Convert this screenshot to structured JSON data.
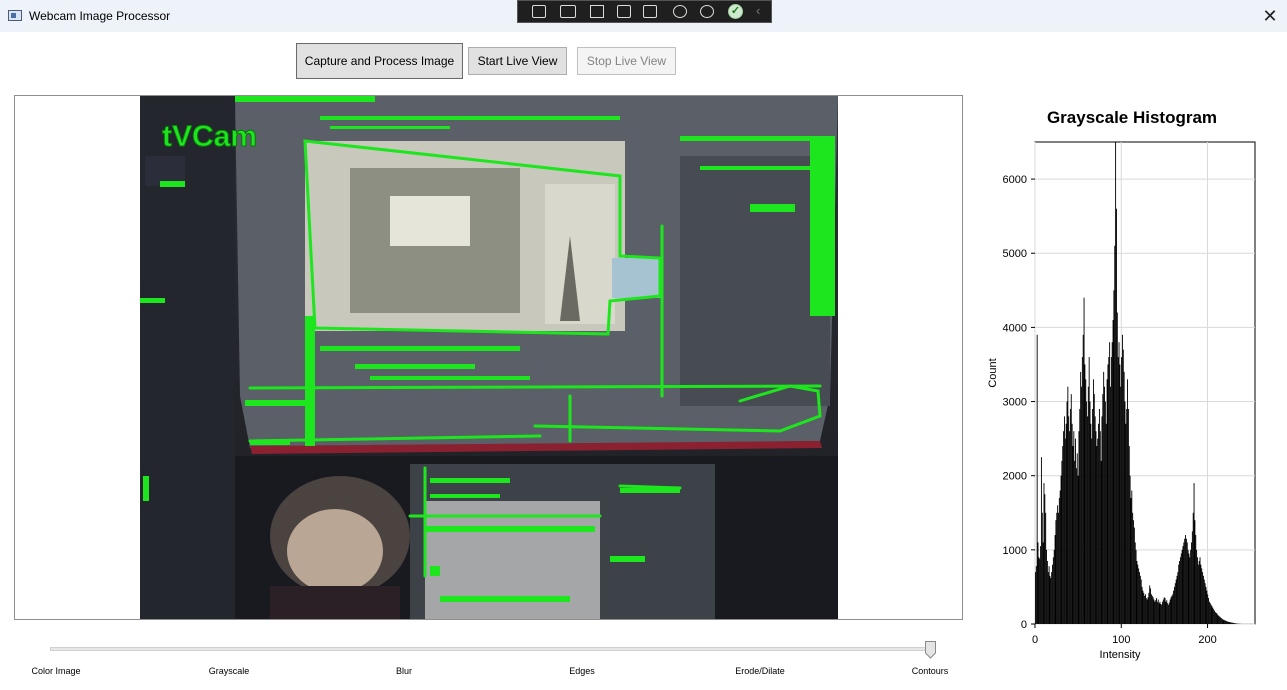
{
  "window": {
    "title": "Webcam Image Processor",
    "close_glyph": "✕"
  },
  "toolbar": {
    "capture_label": "Capture and Process Image",
    "start_label": "Start Live View",
    "stop_label": "Stop Live View"
  },
  "overlay_toolbar": {
    "icons": [
      "select-region-icon",
      "video-icon",
      "pointer-icon",
      "frame-icon",
      "pointer-window-icon",
      "accessibility-icon",
      "person-icon"
    ],
    "check_glyph": "✓",
    "chevron_glyph": "‹"
  },
  "camera": {
    "watermark": "tVCam"
  },
  "chart_data": {
    "type": "bar",
    "title": "Grayscale Histogram",
    "xlabel": "Intensity",
    "ylabel": "Count",
    "xlim": [
      0,
      255
    ],
    "ylim": [
      0,
      6500
    ],
    "xticks": [
      0,
      100,
      200
    ],
    "yticks": [
      0,
      1000,
      2000,
      3000,
      4000,
      5000,
      6000
    ],
    "grid": true,
    "legend": "none",
    "bar_color": "#000000",
    "values": [
      700,
      780,
      3900,
      1100,
      900,
      880,
      1050,
      2250,
      1500,
      1100,
      1900,
      1750,
      1500,
      1000,
      850,
      700,
      780,
      650,
      620,
      700,
      800,
      900,
      1000,
      1200,
      1400,
      1500,
      1600,
      1500,
      1700,
      1800,
      2000,
      2200,
      2400,
      2600,
      2800,
      2500,
      2700,
      3000,
      3200,
      2800,
      2600,
      2900,
      3100,
      2700,
      2400,
      2600,
      2200,
      2500,
      2100,
      2300,
      2000,
      2600,
      2900,
      3400,
      3200,
      3600,
      3900,
      4400,
      3500,
      3300,
      3000,
      2800,
      3200,
      3600,
      3000,
      2700,
      2500,
      2900,
      3300,
      3100,
      2800,
      2600,
      2400,
      2500,
      2700,
      2900,
      2600,
      2200,
      2800,
      3100,
      3400,
      3200,
      3000,
      2700,
      3300,
      3500,
      3600,
      3800,
      3200,
      3600,
      3800,
      4100,
      4500,
      5100,
      6500,
      5600,
      4200,
      3600,
      3800,
      3500,
      3200,
      3600,
      3900,
      3700,
      3400,
      3000,
      2700,
      2900,
      3300,
      2900,
      2400,
      2000,
      1700,
      1800,
      1500,
      1400,
      1300,
      1100,
      1000,
      850,
      800,
      750,
      700,
      650,
      600,
      500,
      450,
      420,
      380,
      400,
      350,
      330,
      360,
      420,
      520,
      480,
      400,
      380,
      360,
      330,
      300,
      320,
      350,
      300,
      330,
      280,
      300,
      270,
      260,
      300,
      330,
      360,
      350,
      300,
      320,
      280,
      260,
      290,
      330,
      360,
      380,
      400,
      450,
      500,
      550,
      600,
      650,
      700,
      800,
      850,
      900,
      950,
      1000,
      1050,
      1100,
      1150,
      1200,
      1150,
      1100,
      1000,
      950,
      900,
      1000,
      1100,
      1250,
      1500,
      1900,
      1400,
      1200,
      1000,
      900,
      800,
      850,
      900,
      800,
      750,
      700,
      650,
      600,
      550,
      500,
      450,
      400,
      350,
      300,
      280,
      260,
      240,
      220,
      200,
      180,
      160,
      150,
      140,
      120,
      110,
      100,
      90,
      80,
      70,
      60,
      55,
      50,
      45,
      40,
      35,
      30,
      28,
      25,
      22,
      20,
      18,
      15,
      12,
      10,
      8,
      6,
      5,
      4,
      3,
      2,
      2,
      1,
      1,
      1,
      1,
      1,
      1,
      1,
      1,
      1,
      1,
      1,
      1,
      1,
      1,
      1,
      1
    ]
  },
  "stages": {
    "labels": [
      "Color Image",
      "Grayscale",
      "Blur",
      "Edges",
      "Erode/Dilate",
      "Contours"
    ],
    "selected_index": 5
  }
}
